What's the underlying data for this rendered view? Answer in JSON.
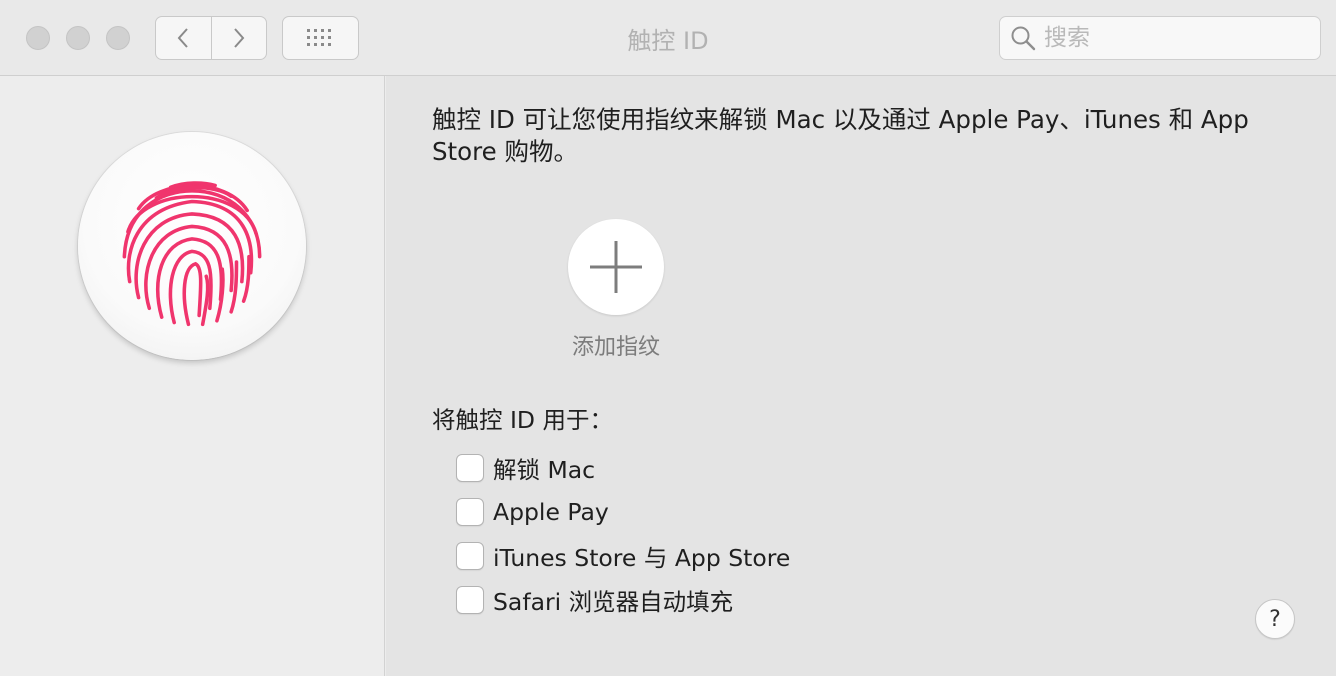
{
  "window": {
    "title": "触控 ID",
    "controls": [
      "close-button",
      "minimize-button",
      "zoom-button"
    ]
  },
  "toolbar": {
    "back_icon": "chevron-left-icon",
    "forward_icon": "chevron-right-icon",
    "show_all_icon": "grid-icon",
    "search": {
      "placeholder": "搜索",
      "value": "",
      "icon": "search-icon"
    }
  },
  "sidebar": {
    "icon": "fingerprint-icon",
    "accent": "#f0356d"
  },
  "main": {
    "description": "触控 ID 可让您使用指纹来解锁 Mac 以及通过 Apple Pay、iTunes 和 App Store 购物。",
    "add_fingerprint": {
      "icon": "plus-icon",
      "label": "添加指纹"
    },
    "use_for_label": "将触控 ID 用于：",
    "options": [
      {
        "label": "解锁 Mac",
        "checked": false
      },
      {
        "label": "Apple Pay",
        "checked": false
      },
      {
        "label": "iTunes Store 与 App Store",
        "checked": false
      },
      {
        "label": "Safari 浏览器自动填充",
        "checked": false
      }
    ],
    "help_label": "?"
  }
}
